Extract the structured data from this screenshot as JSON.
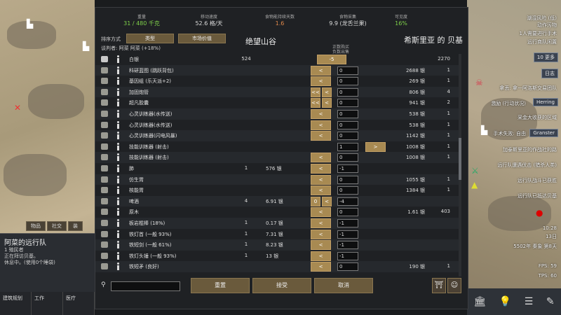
{
  "left_panel": {
    "tabs": [
      "物品",
      "社交",
      "装"
    ],
    "caravan_name": "阿菜的远行队",
    "caravan_lines": [
      "1 殖民者",
      "正在拜访贝基。",
      "休息中。(使用0个睡袋)"
    ],
    "bottom_buttons": [
      "建筑规划",
      "工作",
      "医疗"
    ]
  },
  "right_panel": {
    "notes": [
      "潮湿风险 (低)",
      "动作污物",
      "1人需要进行手术",
      "远行商队闲置"
    ],
    "buttons": [
      "10 更多",
      "日志",
      "Herring",
      "Granster",
      "森蒂"
    ],
    "events": [
      "拿丢: 拿一阿洛斯交易团队",
      "激励 (行动状况)",
      "采金大收获的区域",
      "手术失败: 自由",
      "加泰斯里亚的作战社的路",
      "远行队遭遇伏击 (猎杀人类)",
      "远行队战斗已获胜",
      "远行队已抵达贝基"
    ],
    "time": "10:28",
    "day": "13日",
    "date": "5502年 秦象 第8天",
    "fps": "FPS: 59",
    "tps": "TPS: 60"
  },
  "dialog": {
    "stats": [
      {
        "label": "重量",
        "value": "31 / 480 千克",
        "color": "#7fd14a"
      },
      {
        "label": "移动速度",
        "value": "52.6 格/天",
        "color": "#dddddd"
      },
      {
        "label": "食物能持续天数",
        "value": "1.6",
        "color": "#e0884a"
      },
      {
        "label": "食物采集",
        "value": "9.9 (龙舌兰果)",
        "color": "#dddddd"
      },
      {
        "label": "可见度",
        "value": "16%",
        "color": "#7fd14a"
      }
    ],
    "sort_label": "排序方式",
    "sort_buttons": [
      "类型",
      "市场价值"
    ],
    "negotiator": "谈判者: 阿菜 阿菜 (+18%)",
    "left_title": "绝望山谷",
    "right_title": "希斯里亚 的 贝基",
    "price_label_1": "正数购买",
    "price_label_2": "负数出售",
    "silver_row": {
      "name": "白银",
      "left_qty": "524",
      "amount": "-5",
      "right_qty": "2270"
    },
    "rows": [
      {
        "name": "科研蓝图 (跳跃背包)",
        "lqty": "",
        "lprice": "",
        "b1": "<",
        "b2": "",
        "amt": "0",
        "rprice": "2688 银",
        "rqty": "1"
      },
      {
        "name": "基因组 (乐天派+2)",
        "lqty": "",
        "lprice": "",
        "b1": "<",
        "b2": "",
        "amt": "0",
        "rprice": "269 银",
        "rqty": "1"
      },
      {
        "name": "加固炮管",
        "lqty": "",
        "lprice": "",
        "b1": "<<",
        "b2": "<",
        "amt": "0",
        "rprice": "806 银",
        "rqty": "4"
      },
      {
        "name": "超凡胶囊",
        "lqty": "",
        "lprice": "",
        "b1": "<<",
        "b2": "<",
        "amt": "0",
        "rprice": "941 银",
        "rqty": "2"
      },
      {
        "name": "心灵训练器(水传送)",
        "lqty": "",
        "lprice": "",
        "b1": "<",
        "b2": "",
        "amt": "0",
        "rprice": "538 银",
        "rqty": "1"
      },
      {
        "name": "心灵训练器(水传送)",
        "lqty": "",
        "lprice": "",
        "b1": "<",
        "b2": "",
        "amt": "0",
        "rprice": "538 银",
        "rqty": "1"
      },
      {
        "name": "心灵训练器(闪电风暴)",
        "lqty": "",
        "lprice": "",
        "b1": "<",
        "b2": "",
        "amt": "0",
        "rprice": "1142 银",
        "rqty": "1"
      },
      {
        "name": "技能训练器 (射击)",
        "lqty": "",
        "lprice": "",
        "b1": "",
        "b2": ">",
        "amt": "1",
        "rprice": "1008 银",
        "rqty": "1"
      },
      {
        "name": "技能训练器 (射击)",
        "lqty": "",
        "lprice": "",
        "b1": "<",
        "b2": "",
        "amt": "0",
        "rprice": "1008 银",
        "rqty": "1"
      },
      {
        "name": "肺",
        "lqty": "1",
        "lprice": "576 银",
        "b1": "<",
        "b2": "",
        "amt": "-1",
        "rprice": "",
        "rqty": ""
      },
      {
        "name": "仿生胃",
        "lqty": "",
        "lprice": "",
        "b1": "<",
        "b2": "",
        "amt": "0",
        "rprice": "1055 银",
        "rqty": "1"
      },
      {
        "name": "核能胃",
        "lqty": "",
        "lprice": "",
        "b1": "<",
        "b2": "",
        "amt": "0",
        "rprice": "1384 银",
        "rqty": "1"
      },
      {
        "name": "啤酒",
        "lqty": "4",
        "lprice": "6.91 银",
        "b1": "0",
        "b2": "<",
        "amt": "-4",
        "rprice": "",
        "rqty": ""
      },
      {
        "name": "原木",
        "lqty": "",
        "lprice": "",
        "b1": "<",
        "b2": "",
        "amt": "0",
        "rprice": "1.61 银",
        "rqty": "403"
      },
      {
        "name": "板岩棍棒 (18%)",
        "lqty": "1",
        "lprice": "0.17 银",
        "b1": "<",
        "b2": "",
        "amt": "-1",
        "rprice": "",
        "rqty": ""
      },
      {
        "name": "铁灯首 (一般 93%)",
        "lqty": "1",
        "lprice": "7.31 银",
        "b1": "<",
        "b2": "",
        "amt": "-1",
        "rprice": "",
        "rqty": ""
      },
      {
        "name": "铁短剑 (一般 61%)",
        "lqty": "1",
        "lprice": "8.23 银",
        "b1": "<",
        "b2": "",
        "amt": "-1",
        "rprice": "",
        "rqty": ""
      },
      {
        "name": "铁灯头锤 (一般 93%)",
        "lqty": "1",
        "lprice": "13 银",
        "b1": "<",
        "b2": "",
        "amt": "-1",
        "rprice": "",
        "rqty": ""
      },
      {
        "name": "铁短矛 (良好)",
        "lqty": "",
        "lprice": "",
        "b1": "<",
        "b2": "",
        "amt": "0",
        "rprice": "190 银",
        "rqty": "1"
      }
    ],
    "footer": {
      "reset": "重置",
      "accept": "接受",
      "cancel": "取消"
    }
  }
}
